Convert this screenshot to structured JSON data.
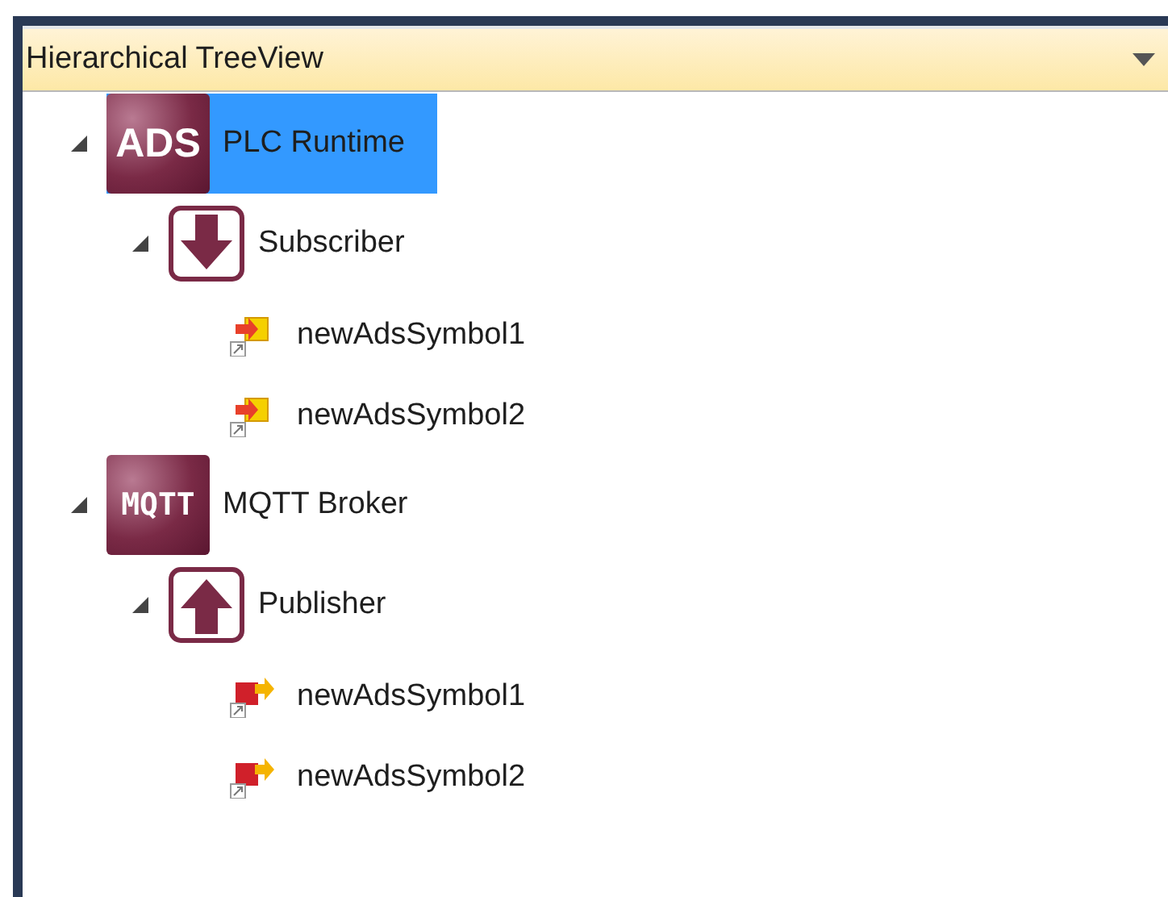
{
  "panel": {
    "title": "Hierarchical TreeView"
  },
  "tree": [
    {
      "kind": "root",
      "badge": "ADS",
      "label": "PLC Runtime",
      "selected": true,
      "expanded": true,
      "children": [
        {
          "kind": "subscriber",
          "label": "Subscriber",
          "selected": false,
          "expanded": true,
          "children": [
            {
              "kind": "input",
              "label": "newAdsSymbol1",
              "selected": false
            },
            {
              "kind": "input",
              "label": "newAdsSymbol2",
              "selected": false
            }
          ]
        }
      ]
    },
    {
      "kind": "root",
      "badge": "MQTT",
      "label": "MQTT Broker",
      "selected": false,
      "expanded": true,
      "children": [
        {
          "kind": "publisher",
          "label": "Publisher",
          "selected": false,
          "expanded": true,
          "children": [
            {
              "kind": "output",
              "label": "newAdsSymbol1",
              "selected": false
            },
            {
              "kind": "output",
              "label": "newAdsSymbol2",
              "selected": false
            }
          ]
        }
      ]
    }
  ]
}
